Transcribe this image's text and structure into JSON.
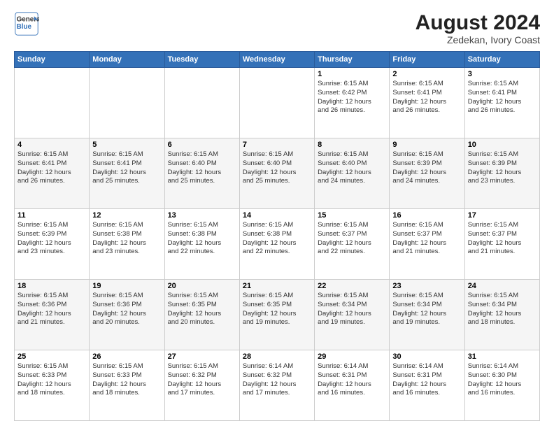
{
  "header": {
    "title": "August 2024",
    "subtitle": "Zedekan, Ivory Coast",
    "logo_line1": "General",
    "logo_line2": "Blue"
  },
  "weekdays": [
    "Sunday",
    "Monday",
    "Tuesday",
    "Wednesday",
    "Thursday",
    "Friday",
    "Saturday"
  ],
  "weeks": [
    [
      {
        "day": "",
        "info": ""
      },
      {
        "day": "",
        "info": ""
      },
      {
        "day": "",
        "info": ""
      },
      {
        "day": "",
        "info": ""
      },
      {
        "day": "1",
        "info": "Sunrise: 6:15 AM\nSunset: 6:42 PM\nDaylight: 12 hours\nand 26 minutes."
      },
      {
        "day": "2",
        "info": "Sunrise: 6:15 AM\nSunset: 6:41 PM\nDaylight: 12 hours\nand 26 minutes."
      },
      {
        "day": "3",
        "info": "Sunrise: 6:15 AM\nSunset: 6:41 PM\nDaylight: 12 hours\nand 26 minutes."
      }
    ],
    [
      {
        "day": "4",
        "info": "Sunrise: 6:15 AM\nSunset: 6:41 PM\nDaylight: 12 hours\nand 26 minutes."
      },
      {
        "day": "5",
        "info": "Sunrise: 6:15 AM\nSunset: 6:41 PM\nDaylight: 12 hours\nand 25 minutes."
      },
      {
        "day": "6",
        "info": "Sunrise: 6:15 AM\nSunset: 6:40 PM\nDaylight: 12 hours\nand 25 minutes."
      },
      {
        "day": "7",
        "info": "Sunrise: 6:15 AM\nSunset: 6:40 PM\nDaylight: 12 hours\nand 25 minutes."
      },
      {
        "day": "8",
        "info": "Sunrise: 6:15 AM\nSunset: 6:40 PM\nDaylight: 12 hours\nand 24 minutes."
      },
      {
        "day": "9",
        "info": "Sunrise: 6:15 AM\nSunset: 6:39 PM\nDaylight: 12 hours\nand 24 minutes."
      },
      {
        "day": "10",
        "info": "Sunrise: 6:15 AM\nSunset: 6:39 PM\nDaylight: 12 hours\nand 23 minutes."
      }
    ],
    [
      {
        "day": "11",
        "info": "Sunrise: 6:15 AM\nSunset: 6:39 PM\nDaylight: 12 hours\nand 23 minutes."
      },
      {
        "day": "12",
        "info": "Sunrise: 6:15 AM\nSunset: 6:38 PM\nDaylight: 12 hours\nand 23 minutes."
      },
      {
        "day": "13",
        "info": "Sunrise: 6:15 AM\nSunset: 6:38 PM\nDaylight: 12 hours\nand 22 minutes."
      },
      {
        "day": "14",
        "info": "Sunrise: 6:15 AM\nSunset: 6:38 PM\nDaylight: 12 hours\nand 22 minutes."
      },
      {
        "day": "15",
        "info": "Sunrise: 6:15 AM\nSunset: 6:37 PM\nDaylight: 12 hours\nand 22 minutes."
      },
      {
        "day": "16",
        "info": "Sunrise: 6:15 AM\nSunset: 6:37 PM\nDaylight: 12 hours\nand 21 minutes."
      },
      {
        "day": "17",
        "info": "Sunrise: 6:15 AM\nSunset: 6:37 PM\nDaylight: 12 hours\nand 21 minutes."
      }
    ],
    [
      {
        "day": "18",
        "info": "Sunrise: 6:15 AM\nSunset: 6:36 PM\nDaylight: 12 hours\nand 21 minutes."
      },
      {
        "day": "19",
        "info": "Sunrise: 6:15 AM\nSunset: 6:36 PM\nDaylight: 12 hours\nand 20 minutes."
      },
      {
        "day": "20",
        "info": "Sunrise: 6:15 AM\nSunset: 6:35 PM\nDaylight: 12 hours\nand 20 minutes."
      },
      {
        "day": "21",
        "info": "Sunrise: 6:15 AM\nSunset: 6:35 PM\nDaylight: 12 hours\nand 19 minutes."
      },
      {
        "day": "22",
        "info": "Sunrise: 6:15 AM\nSunset: 6:34 PM\nDaylight: 12 hours\nand 19 minutes."
      },
      {
        "day": "23",
        "info": "Sunrise: 6:15 AM\nSunset: 6:34 PM\nDaylight: 12 hours\nand 19 minutes."
      },
      {
        "day": "24",
        "info": "Sunrise: 6:15 AM\nSunset: 6:34 PM\nDaylight: 12 hours\nand 18 minutes."
      }
    ],
    [
      {
        "day": "25",
        "info": "Sunrise: 6:15 AM\nSunset: 6:33 PM\nDaylight: 12 hours\nand 18 minutes."
      },
      {
        "day": "26",
        "info": "Sunrise: 6:15 AM\nSunset: 6:33 PM\nDaylight: 12 hours\nand 18 minutes."
      },
      {
        "day": "27",
        "info": "Sunrise: 6:15 AM\nSunset: 6:32 PM\nDaylight: 12 hours\nand 17 minutes."
      },
      {
        "day": "28",
        "info": "Sunrise: 6:14 AM\nSunset: 6:32 PM\nDaylight: 12 hours\nand 17 minutes."
      },
      {
        "day": "29",
        "info": "Sunrise: 6:14 AM\nSunset: 6:31 PM\nDaylight: 12 hours\nand 16 minutes."
      },
      {
        "day": "30",
        "info": "Sunrise: 6:14 AM\nSunset: 6:31 PM\nDaylight: 12 hours\nand 16 minutes."
      },
      {
        "day": "31",
        "info": "Sunrise: 6:14 AM\nSunset: 6:30 PM\nDaylight: 12 hours\nand 16 minutes."
      }
    ]
  ]
}
